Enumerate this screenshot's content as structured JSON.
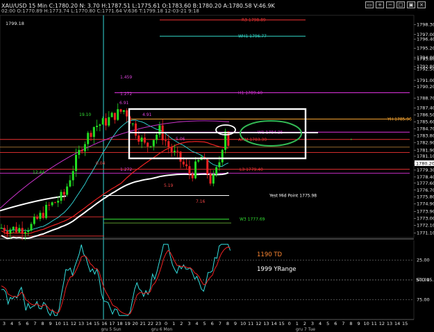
{
  "window": {
    "symbol_line": "XAU/USD 15 Min   C:1780.20  N:   3.70  H:1787.51  L:1775.61  O:1783.60  B:1780.20  A:1780.58  V:46.9K",
    "status_line": "02:00  O:1770.89  H:1773.74  L:1770.80  C:1771.64  V:636   T:1799.18  12-03-21  9:18"
  },
  "colors": {
    "background": "#000000",
    "bull": "#22dd22",
    "bear": "#ee2222",
    "fib": "#dd22dd",
    "box": "#ffffff",
    "ellipse": "#33bb55"
  },
  "chart_data": {
    "type": "line",
    "title": "XAU/USD 15 Min",
    "price_labels": [
      "1798.30",
      "1797.00",
      "1796.40",
      "1795.20",
      "1794.00",
      "1793.80",
      "1792.80",
      "1792.50",
      "1791.00",
      "1790.20",
      "1788.70",
      "1787.40",
      "1786.50",
      "1785.60",
      "1784.70",
      "1783.80",
      "1782.90",
      "1781.90",
      "1781.10",
      "1780.20",
      "1779.30",
      "1778.40",
      "1777.60",
      "1776.70",
      "1775.80",
      "1774.90",
      "1773.90",
      "1773.00",
      "1772.10",
      "1771.10"
    ],
    "time_labels": [
      "3",
      "4",
      "5",
      "6",
      "7",
      "8",
      "9",
      "10",
      "11",
      "12",
      "13",
      "14",
      "15",
      "16",
      "17",
      "18",
      "19",
      "20",
      "21",
      "22",
      "23",
      "0",
      "1",
      "2",
      "3",
      "4",
      "5",
      "6",
      "7",
      "8",
      "9",
      "10",
      "11",
      "12",
      "13",
      "14",
      "15",
      "0",
      "1",
      "2",
      "3",
      "4",
      "5",
      "6",
      "7",
      "8",
      "9",
      "10",
      "11",
      "12",
      "13",
      "14",
      "15"
    ],
    "date_labels": [
      "gru 5 Sun",
      "gru 6 Mon",
      "gru 7 Tue"
    ],
    "current_price": "1780.20",
    "corner_price": "1799.18",
    "levels": [
      {
        "text": "R3 1798.89",
        "price": 1798.89,
        "color": "#ee3333"
      },
      {
        "text": "WH1 1796.77",
        "price": 1796.77,
        "color": "#33ddcc"
      },
      {
        "text": "H1 1789.40",
        "price": 1789.4,
        "color": "#dd33dd"
      },
      {
        "text": "YH 1785.96",
        "price": 1785.96,
        "color": "#ffaa33"
      },
      {
        "text": "W1 1784.25",
        "price": 1784.25,
        "color": "#dd33dd"
      },
      {
        "text": "AMM 1783.30",
        "price": 1783.3,
        "color": "#ee3333"
      },
      {
        "text": "L3 1779.40",
        "price": 1779.4,
        "color": "#ee3333"
      },
      {
        "text": "Yest Mid Point 1775.98",
        "price": 1775.98,
        "color": "#ffffff"
      },
      {
        "text": "W3 1777.69",
        "price": 1772.9,
        "color": "#33dd33"
      }
    ],
    "fib_labels": [
      "1.459",
      "1.272",
      "4.91",
      "5.06",
      "6.91",
      "1.272",
      "5.19",
      "7.16",
      "19.10",
      "12.44",
      "0.04"
    ],
    "oscillator": {
      "name": "STO 15.00",
      "labels": [
        "25.00",
        "50.00",
        "75.00"
      ],
      "td_text": "1190 TD",
      "range_text": "1999 YRange"
    }
  }
}
